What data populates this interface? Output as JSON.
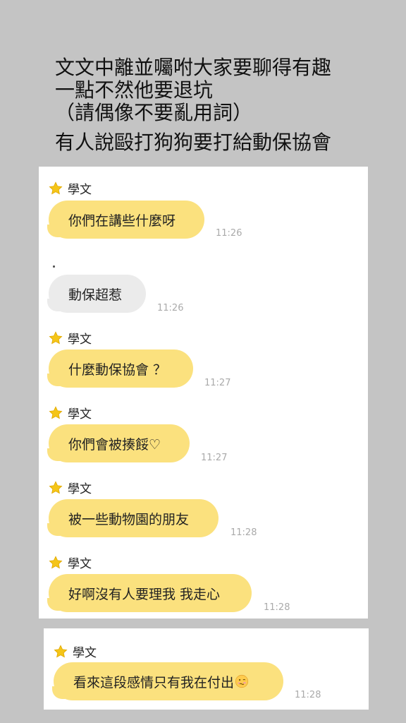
{
  "caption": {
    "line1": "文文中離並囑咐大家要聊得有趣",
    "line2": "一點不然他要退坑",
    "line3": "（請偶像不要亂用詞）",
    "line4": "有人說毆打狗狗要打給動保協會"
  },
  "chat": {
    "messages": [
      {
        "sender": "學文",
        "text": "你們在講些什麼呀",
        "time": "11:26"
      },
      {
        "sender": "",
        "text": "動保超惹",
        "time": "11:26"
      },
      {
        "sender": "學文",
        "text": "什麼動保協會 ？",
        "time": "11:27"
      },
      {
        "sender": "學文",
        "text": "你們會被揍餒♡",
        "time": "11:27"
      },
      {
        "sender": "學文",
        "text": "被一些動物園的朋友",
        "time": "11:28"
      },
      {
        "sender": "學文",
        "text": "好啊沒有人要理我 我走心",
        "time": "11:28"
      },
      {
        "sender": "學文",
        "text": "看來這段感情只有我在付出",
        "time": "11:28",
        "emoji": "woozy-face"
      }
    ]
  },
  "colors": {
    "background": "#c4c4c4",
    "bubble_yellow": "#fbe17e",
    "bubble_gray": "#ebebeb",
    "star": "#f5c518",
    "timestamp": "#aaaaaa"
  }
}
